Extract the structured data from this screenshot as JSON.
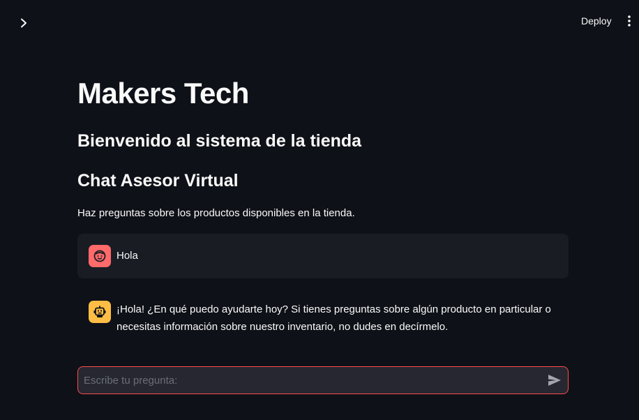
{
  "header": {
    "deploy_label": "Deploy"
  },
  "main": {
    "title": "Makers Tech",
    "subtitle": "Bienvenido al sistema de la tienda",
    "section_title": "Chat Asesor Virtual",
    "description": "Haz preguntas sobre los productos disponibles en la tienda."
  },
  "messages": [
    {
      "role": "user",
      "text": "Hola"
    },
    {
      "role": "assistant",
      "text": "¡Hola! ¿En qué puedo ayudarte hoy? Si tienes preguntas sobre algún producto en particular o necesitas información sobre nuestro inventario, no dudes en decírmelo."
    }
  ],
  "chat_input": {
    "placeholder": "Escribe tu pregunta:",
    "value": ""
  },
  "colors": {
    "background": "#0e1117",
    "user_message_bg": "#1a1c24",
    "user_avatar": "#ff6a6a",
    "assistant_avatar": "#ffbd45",
    "input_border": "#ff4b4b"
  },
  "icons": {
    "sidebar_toggle": "chevron-right-icon",
    "menu": "vertical-dots-icon",
    "user_avatar": "smiley-face-icon",
    "assistant_avatar": "robot-icon",
    "send": "send-arrow-icon"
  }
}
